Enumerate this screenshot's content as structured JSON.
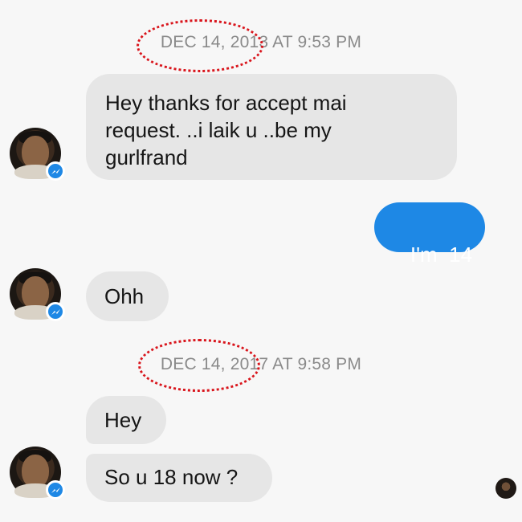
{
  "conversation": {
    "timestamp_1": {
      "date": "DEC 14, 2013",
      "rest": "AT 9:53 PM"
    },
    "timestamp_2": {
      "date": "DEC 14, 2017",
      "rest": "AT 9:58 PM"
    },
    "messages": [
      {
        "side": "received",
        "lines": [
          "Hey thanks for accept mai",
          "request. ..i laik u ..be my",
          "gurlfrand"
        ]
      },
      {
        "side": "sent",
        "text": "I'm  14"
      },
      {
        "side": "received",
        "text": "Ohh"
      },
      {
        "side": "received",
        "text": "Hey"
      },
      {
        "side": "received",
        "text": "So u 18 now ?"
      }
    ]
  },
  "icons": {
    "contact_avatar": "avatar",
    "messenger_badge": "messenger-icon",
    "seen_avatar": "avatar"
  },
  "colors": {
    "background": "#f7f7f7",
    "received_bubble": "#e6e6e6",
    "sent_bubble": "#1e88e5",
    "timestamp": "#8a8a8a",
    "highlight_ring": "#d9151c"
  }
}
